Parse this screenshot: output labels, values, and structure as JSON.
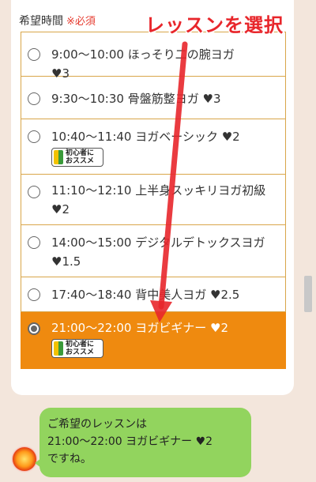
{
  "form": {
    "field_label": "希望時間",
    "required_mark": "※必須"
  },
  "options": [
    {
      "time": "9:00〜10:00",
      "name": "ほっそり二の腕ヨガ",
      "hearts": "♥3",
      "selected": false
    },
    {
      "time": "9:30〜10:30",
      "name": "骨盤筋整ヨガ",
      "hearts": "♥3",
      "selected": false
    },
    {
      "time": "10:40〜11:40",
      "name": "ヨガベーシック",
      "hearts": "♥2",
      "selected": false,
      "badge": "初心者におススメ"
    },
    {
      "time": "11:10〜12:10",
      "name": "上半身スッキリヨガ初級",
      "hearts": "♥2",
      "selected": false
    },
    {
      "time": "14:00〜15:00",
      "name": "デジタルデトックスヨガ",
      "hearts": "♥1.5",
      "selected": false
    },
    {
      "time": "17:40〜18:40",
      "name": "背中美人ヨガ",
      "hearts": "♥2.5",
      "selected": false
    },
    {
      "time": "21:00〜22:00",
      "name": "ヨガビギナー",
      "hearts": "♥2",
      "selected": true,
      "badge": "初心者におススメ"
    }
  ],
  "badge": {
    "line1": "初心者に",
    "line2": "おススメ"
  },
  "annotation": {
    "text": "レッスンを選択",
    "color": "#e8262b"
  },
  "chat": {
    "line1": "ご希望のレッスンは",
    "line2": "21:00〜22:00 ヨガビギナー ♥2",
    "line3": "ですね。"
  },
  "colors": {
    "accent": "#ef8a0f",
    "border": "#d9a64a",
    "bubble": "#92d45e",
    "background": "#f3e6dc"
  }
}
